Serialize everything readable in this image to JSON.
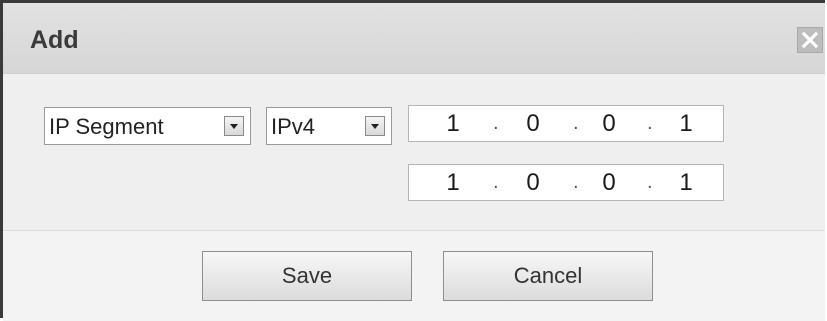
{
  "dialog": {
    "title": "Add",
    "close_icon": "close-icon"
  },
  "form": {
    "range_type": {
      "selected": "IP Segment"
    },
    "ip_version": {
      "selected": "IPv4"
    },
    "start_ip": {
      "octets": [
        "1",
        "0",
        "0",
        "1"
      ]
    },
    "end_ip": {
      "octets": [
        "1",
        "0",
        "0",
        "1"
      ]
    },
    "separator": "."
  },
  "footer": {
    "save_label": "Save",
    "cancel_label": "Cancel"
  }
}
